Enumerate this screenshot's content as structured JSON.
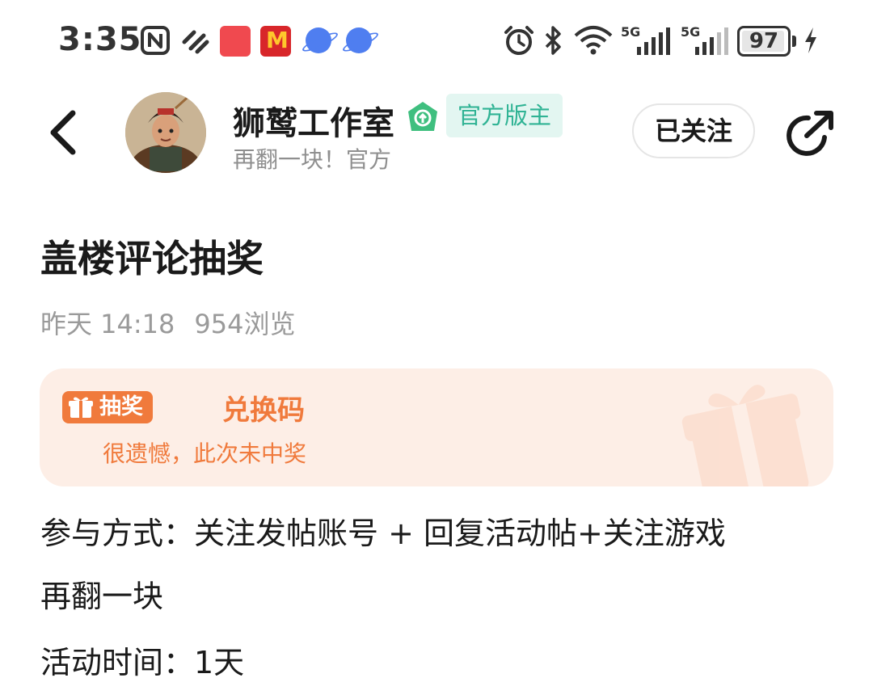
{
  "status_bar": {
    "time": "3:35",
    "battery": "97",
    "battery_level": 0.97,
    "network1": "5G",
    "network2": "5G"
  },
  "header": {
    "author_name": "狮鹫工作室",
    "role_badge": "官方版主",
    "author_subtitle": "再翻一块！官方",
    "follow_label": "已关注"
  },
  "post": {
    "title": "盖楼评论抽奖",
    "date": "昨天 14:18",
    "views": "954浏览",
    "lottery": {
      "tag": "抽奖",
      "prize": "兑换码",
      "result": "很遗憾，此次未中奖"
    },
    "body": {
      "line1": "参与方式：关注发帖账号 + 回复活动帖+关注游戏",
      "line2": "再翻一块",
      "line3": "活动时间：1天"
    }
  },
  "colors": {
    "accent_orange": "#f07a3c",
    "badge_green": "#2fb394",
    "card_bg": "#fdeee6"
  }
}
